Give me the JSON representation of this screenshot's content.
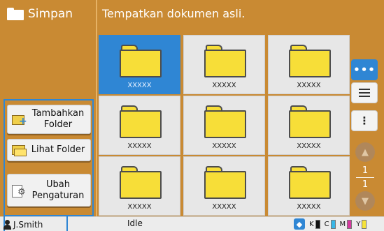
{
  "header": {
    "title": "Simpan",
    "message": "Tempatkan dokumen asli."
  },
  "folders": [
    {
      "label": "XXXXX",
      "selected": true
    },
    {
      "label": "XXXXX",
      "selected": false
    },
    {
      "label": "XXXXX",
      "selected": false
    },
    {
      "label": "XXXXX",
      "selected": false
    },
    {
      "label": "XXXXX",
      "selected": false
    },
    {
      "label": "XXXXX",
      "selected": false
    },
    {
      "label": "XXXXX",
      "selected": false
    },
    {
      "label": "XXXXX",
      "selected": false
    },
    {
      "label": "XXXXX",
      "selected": false
    }
  ],
  "left_menu": {
    "add_folder": {
      "line1": "Tambahkan",
      "line2": "Folder"
    },
    "view_folder": "Lihat Folder",
    "change_settings": {
      "line1": "Ubah",
      "line2": "Pengaturan"
    }
  },
  "pagination": {
    "current": "1",
    "total": "1"
  },
  "status": {
    "user": "J.Smith",
    "state": "Idle",
    "inks": [
      {
        "letter": "K",
        "color": "#111111"
      },
      {
        "letter": "C",
        "color": "#38b7e8"
      },
      {
        "letter": "M",
        "color": "#d63aa0"
      },
      {
        "letter": "Y",
        "color": "#f6e33a"
      }
    ]
  },
  "colors": {
    "accent": "#c98a33",
    "selected": "#2f86d4",
    "folder": "#f7de38"
  }
}
